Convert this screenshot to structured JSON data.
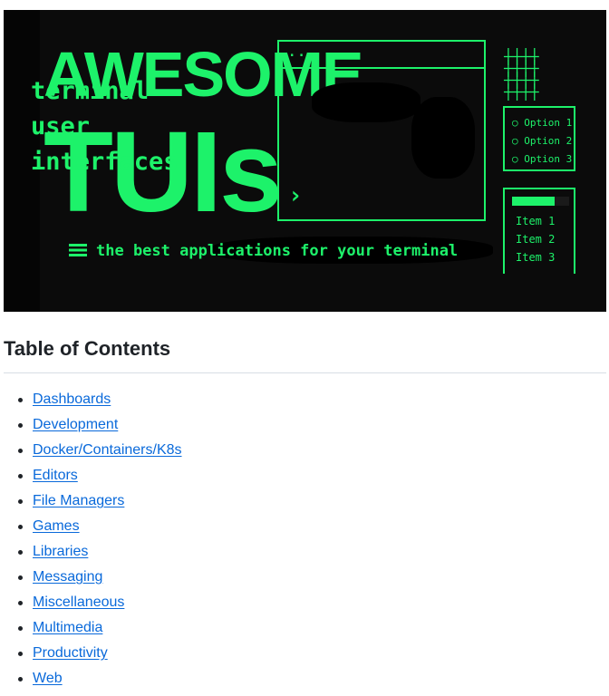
{
  "banner": {
    "title_line1": "AWESOME",
    "title_line2": "TUIs",
    "window_dots": "...",
    "terminal_lines": [
      "terminal",
      "user",
      "interfaces"
    ],
    "prompt_symbol": "›",
    "options": [
      "Option 1",
      "Option 2",
      "Option 3"
    ],
    "items": [
      "Item 1",
      "Item 2",
      "Item 3"
    ],
    "progress_fraction": 0.75,
    "tagline": "the best applications for your terminal",
    "accent_color": "#1df26a",
    "background_color": "#0b0b0b"
  },
  "toc": {
    "heading": "Table of Contents",
    "items": [
      "Dashboards",
      "Development",
      "Docker/Containers/K8s",
      "Editors",
      "File Managers",
      "Games",
      "Libraries",
      "Messaging",
      "Miscellaneous",
      "Multimedia",
      "Productivity",
      "Web"
    ],
    "link_color": "#0969da"
  }
}
